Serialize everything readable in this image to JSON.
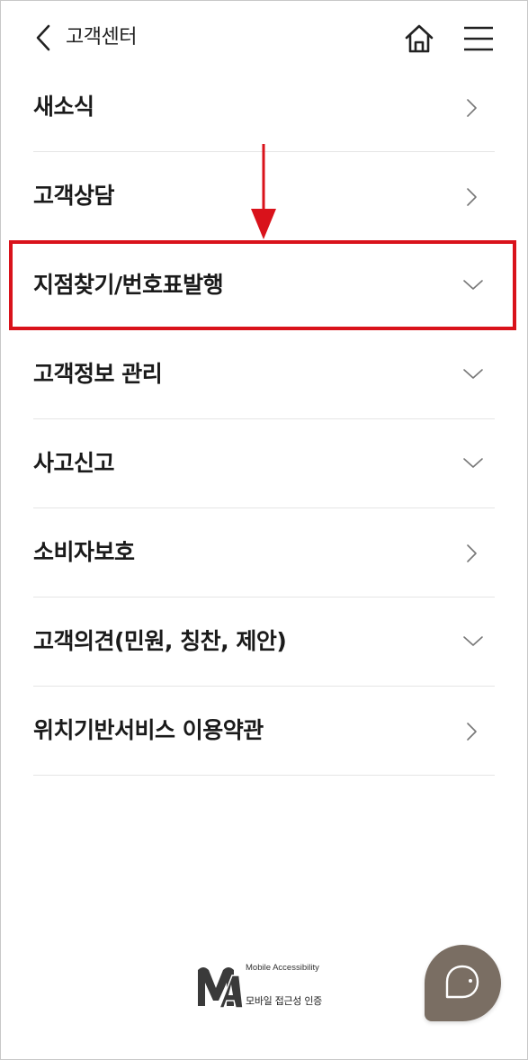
{
  "header": {
    "title": "고객센터",
    "back_icon": "chevron-left-icon",
    "home_icon": "home-icon",
    "menu_icon": "hamburger-menu-icon"
  },
  "menu": {
    "items": [
      {
        "label": "새소식",
        "arrow": "chevron-right-icon"
      },
      {
        "label": "고객상담",
        "arrow": "chevron-right-icon"
      },
      {
        "label": "지점찾기/번호표발행",
        "arrow": "chevron-down-icon",
        "highlighted": true
      },
      {
        "label": "고객정보 관리",
        "arrow": "chevron-down-icon"
      },
      {
        "label": "사고신고",
        "arrow": "chevron-down-icon"
      },
      {
        "label": "소비자보호",
        "arrow": "chevron-right-icon"
      },
      {
        "label": "고객의견(민원, 칭찬, 제안)",
        "arrow": "chevron-down-icon"
      },
      {
        "label": "위치기반서비스 이용약관",
        "arrow": "chevron-right-icon"
      }
    ]
  },
  "footer": {
    "ma_line1": "Mobile Accessibility",
    "ma_line2": "모바일 접근성 인증",
    "logo_letters": "MA"
  },
  "chat_button": {
    "icon": "chat-bubble-icon"
  },
  "colors": {
    "highlight": "#d9121b",
    "chat_fab": "#7a6e63",
    "divider": "#e5e5e5"
  }
}
